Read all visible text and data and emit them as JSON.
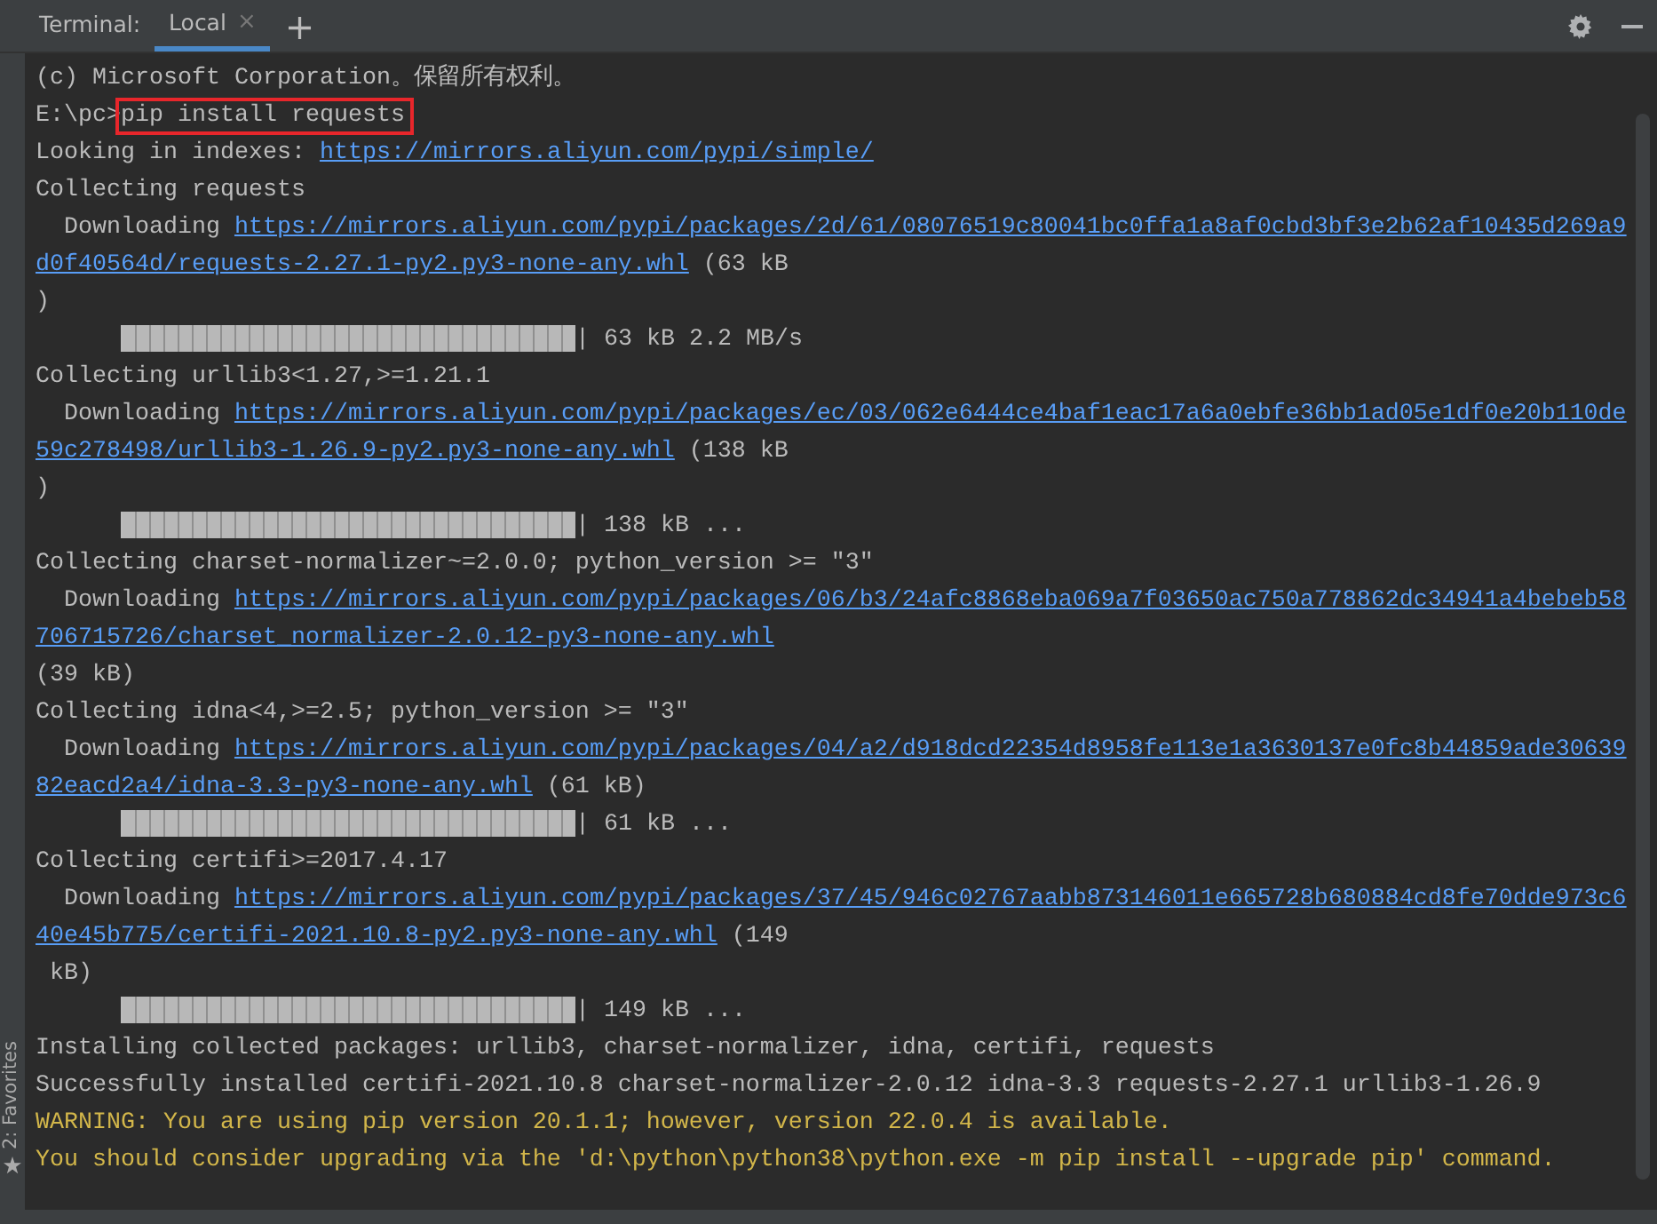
{
  "toolbar": {
    "title": "Terminal:",
    "tabs": [
      {
        "label": "Local",
        "selected": true,
        "close": "×"
      }
    ],
    "add": "+"
  },
  "side_panel": {
    "label": "2: Favorites"
  },
  "lines": [
    {
      "kind": "output",
      "segments": [
        {
          "kind": "text",
          "text": "(c) Microsoft Corporation。保留所有权利。"
        }
      ]
    },
    {
      "kind": "output",
      "segments": [
        {
          "kind": "text",
          "text": "E:\\pc>"
        },
        {
          "kind": "text",
          "text": "pip install requests",
          "highlighted": true
        }
      ]
    },
    {
      "kind": "output",
      "segments": [
        {
          "kind": "text",
          "text": "Looking in indexes: "
        },
        {
          "kind": "link",
          "text": "https://mirrors.aliyun.com/pypi/simple/"
        }
      ]
    },
    {
      "kind": "output",
      "segments": [
        {
          "kind": "text",
          "text": "Collecting requests"
        }
      ]
    },
    {
      "kind": "output",
      "segments": [
        {
          "kind": "text",
          "text": "  Downloading "
        },
        {
          "kind": "link",
          "text": "https://mirrors.aliyun.com/pypi/packages/2d/61/08076519c80041bc0ffa1a8af0cbd3bf3e2b62af10435d269a9"
        }
      ]
    },
    {
      "kind": "output",
      "segments": [
        {
          "kind": "link",
          "text": "d0f40564d/requests-2.27.1-py2.py3-none-any.whl"
        },
        {
          "kind": "text",
          "text": " (63 kB"
        }
      ]
    },
    {
      "kind": "output",
      "segments": [
        {
          "kind": "text",
          "text": ")"
        }
      ]
    },
    {
      "kind": "progress",
      "level": 1,
      "reading": "| 63 kB 2.2 MB/s"
    },
    {
      "kind": "output",
      "segments": [
        {
          "kind": "text",
          "text": "Collecting urllib3<1.27,>=1.21.1"
        }
      ]
    },
    {
      "kind": "output",
      "segments": [
        {
          "kind": "text",
          "text": "  Downloading "
        },
        {
          "kind": "link",
          "text": "https://mirrors.aliyun.com/pypi/packages/ec/03/062e6444ce4baf1eac17a6a0ebfe36bb1ad05e1df0e20b110de"
        }
      ]
    },
    {
      "kind": "output",
      "segments": [
        {
          "kind": "link",
          "text": "59c278498/urllib3-1.26.9-py2.py3-none-any.whl"
        },
        {
          "kind": "text",
          "text": " (138 kB"
        }
      ]
    },
    {
      "kind": "output",
      "segments": [
        {
          "kind": "text",
          "text": ")"
        }
      ]
    },
    {
      "kind": "progress",
      "level": 1,
      "reading": "| 138 kB ..."
    },
    {
      "kind": "output",
      "segments": [
        {
          "kind": "text",
          "text": "Collecting charset-normalizer~=2.0.0; python_version >= \"3\""
        }
      ]
    },
    {
      "kind": "output",
      "segments": [
        {
          "kind": "text",
          "text": "  Downloading "
        },
        {
          "kind": "link",
          "text": "https://mirrors.aliyun.com/pypi/packages/06/b3/24afc8868eba069a7f03650ac750a778862dc34941a4bebeb58"
        }
      ]
    },
    {
      "kind": "output",
      "segments": [
        {
          "kind": "link",
          "text": "706715726/charset_normalizer-2.0.12-py3-none-any.whl"
        }
      ]
    },
    {
      "kind": "output",
      "segments": [
        {
          "kind": "text",
          "text": "(39 kB)"
        }
      ]
    },
    {
      "kind": "output",
      "segments": [
        {
          "kind": "text",
          "text": "Collecting idna<4,>=2.5; python_version >= \"3\""
        }
      ]
    },
    {
      "kind": "output",
      "segments": [
        {
          "kind": "text",
          "text": "  Downloading "
        },
        {
          "kind": "link",
          "text": "https://mirrors.aliyun.com/pypi/packages/04/a2/d918dcd22354d8958fe113e1a3630137e0fc8b44859ade30639"
        }
      ]
    },
    {
      "kind": "output",
      "segments": [
        {
          "kind": "link",
          "text": "82eacd2a4/idna-3.3-py3-none-any.whl"
        },
        {
          "kind": "text",
          "text": " (61 kB)"
        }
      ]
    },
    {
      "kind": "progress",
      "level": 1,
      "reading": "| 61 kB ..."
    },
    {
      "kind": "output",
      "segments": [
        {
          "kind": "text",
          "text": "Collecting certifi>=2017.4.17"
        }
      ]
    },
    {
      "kind": "output",
      "segments": [
        {
          "kind": "text",
          "text": "  Downloading "
        },
        {
          "kind": "link",
          "text": "https://mirrors.aliyun.com/pypi/packages/37/45/946c02767aabb873146011e665728b680884cd8fe70dde973c6"
        }
      ]
    },
    {
      "kind": "output",
      "segments": [
        {
          "kind": "link",
          "text": "40e45b775/certifi-2021.10.8-py2.py3-none-any.whl"
        },
        {
          "kind": "text",
          "text": " (149"
        }
      ]
    },
    {
      "kind": "output",
      "segments": [
        {
          "kind": "text",
          "text": " kB)"
        }
      ]
    },
    {
      "kind": "progress",
      "level": 1,
      "reading": "| 149 kB ..."
    },
    {
      "kind": "output",
      "segments": [
        {
          "kind": "text",
          "text": "Installing collected packages: urllib3, charset-normalizer, idna, certifi, requests"
        }
      ]
    },
    {
      "kind": "output",
      "segments": [
        {
          "kind": "text",
          "text": "Successfully installed certifi-2021.10.8 charset-normalizer-2.0.12 idna-3.3 requests-2.27.1 urllib3-1.26.9"
        }
      ]
    },
    {
      "kind": "warning",
      "segments": [
        {
          "kind": "text",
          "text": "WARNING: You are using pip version 20.1.1; however, version 22.0.4 is available."
        }
      ]
    },
    {
      "kind": "warning",
      "segments": [
        {
          "kind": "text",
          "text": "You should consider upgrading via the 'd:\\python\\python38\\python.exe -m pip install --upgrade pip' command."
        }
      ]
    }
  ]
}
